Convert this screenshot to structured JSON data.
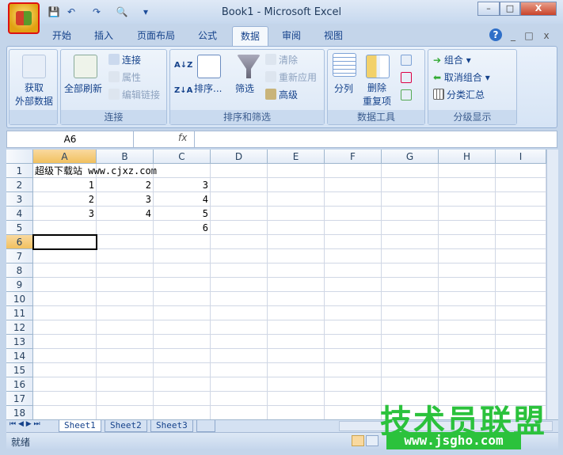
{
  "window": {
    "title": "Book1 - Microsoft Excel",
    "minimize": "–",
    "restore": "□",
    "close": "X"
  },
  "qat": {
    "save": "💾",
    "undo": "↶",
    "redo": "↷",
    "preview": "🔍",
    "customize": "▾"
  },
  "tabs": [
    {
      "label": "开始"
    },
    {
      "label": "插入"
    },
    {
      "label": "页面布局"
    },
    {
      "label": "公式"
    },
    {
      "label": "数据",
      "active": true
    },
    {
      "label": "审阅"
    },
    {
      "label": "视图"
    }
  ],
  "ribbon_controls": {
    "help": "?",
    "minimize": "_",
    "restore": "□",
    "close": "x"
  },
  "ribbon": {
    "get_external": {
      "label": "获取\n外部数据",
      "group": ""
    },
    "connections": {
      "group": "连接",
      "refresh_all": "全部刷新",
      "connections": "连接",
      "properties": "属性",
      "edit_links": "编辑链接"
    },
    "sort_filter": {
      "group": "排序和筛选",
      "sort_asc": "A↓Z",
      "sort_desc": "Z↓A",
      "sort": "排序...",
      "filter": "筛选",
      "clear": "清除",
      "reapply": "重新应用",
      "advanced": "高级"
    },
    "data_tools": {
      "group": "数据工具",
      "text_to_columns": "分列",
      "remove_duplicates": "删除\n重复项"
    },
    "outline": {
      "group": "分级显示",
      "group_btn": "组合",
      "ungroup": "取消组合",
      "subtotal": "分类汇总"
    }
  },
  "formula_bar": {
    "name_box": "A6",
    "fx": "fx",
    "formula": ""
  },
  "columns": [
    "A",
    "B",
    "C",
    "D",
    "E",
    "F",
    "G",
    "H",
    "I"
  ],
  "selected": {
    "col": "A",
    "row": 6
  },
  "rows": [
    [
      "超级下载站 www.cjxz.com",
      "",
      "",
      "",
      "",
      "",
      "",
      "",
      ""
    ],
    [
      "1",
      "2",
      "3",
      "",
      "",
      "",
      "",
      "",
      ""
    ],
    [
      "2",
      "3",
      "4",
      "",
      "",
      "",
      "",
      "",
      ""
    ],
    [
      "3",
      "4",
      "5",
      "",
      "",
      "",
      "",
      "",
      ""
    ],
    [
      "",
      "",
      "6",
      "",
      "",
      "",
      "",
      "",
      ""
    ],
    [
      "",
      "",
      "",
      "",
      "",
      "",
      "",
      "",
      ""
    ],
    [
      "",
      "",
      "",
      "",
      "",
      "",
      "",
      "",
      ""
    ],
    [
      "",
      "",
      "",
      "",
      "",
      "",
      "",
      "",
      ""
    ],
    [
      "",
      "",
      "",
      "",
      "",
      "",
      "",
      "",
      ""
    ],
    [
      "",
      "",
      "",
      "",
      "",
      "",
      "",
      "",
      ""
    ],
    [
      "",
      "",
      "",
      "",
      "",
      "",
      "",
      "",
      ""
    ],
    [
      "",
      "",
      "",
      "",
      "",
      "",
      "",
      "",
      ""
    ],
    [
      "",
      "",
      "",
      "",
      "",
      "",
      "",
      "",
      ""
    ],
    [
      "",
      "",
      "",
      "",
      "",
      "",
      "",
      "",
      ""
    ],
    [
      "",
      "",
      "",
      "",
      "",
      "",
      "",
      "",
      ""
    ],
    [
      "",
      "",
      "",
      "",
      "",
      "",
      "",
      "",
      ""
    ],
    [
      "",
      "",
      "",
      "",
      "",
      "",
      "",
      "",
      ""
    ],
    [
      "",
      "",
      "",
      "",
      "",
      "",
      "",
      "",
      ""
    ]
  ],
  "sheets": [
    "Sheet1",
    "Sheet2",
    "Sheet3"
  ],
  "active_sheet": "Sheet1",
  "status": {
    "text": "就绪"
  },
  "watermark": {
    "title": "技术员联盟",
    "url": "www.jsgho.com"
  }
}
